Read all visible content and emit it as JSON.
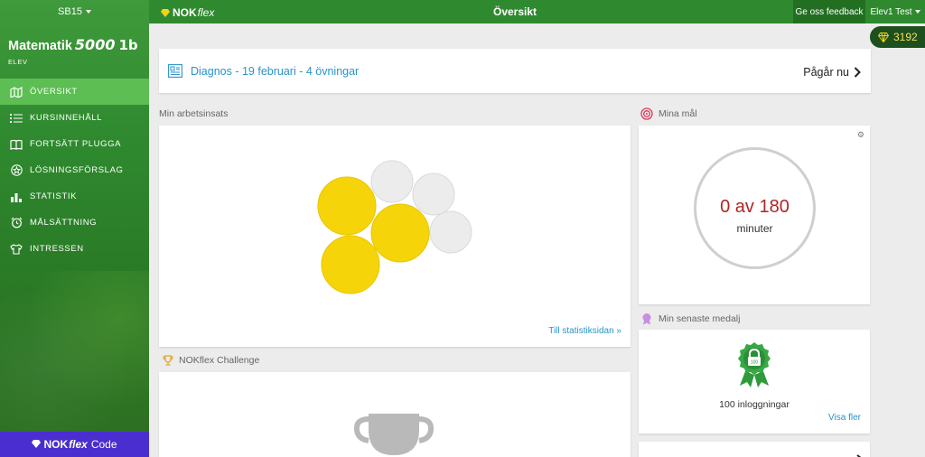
{
  "sidebar": {
    "selector_label": "SB15",
    "course": {
      "name": "Matematik",
      "number": "5000",
      "level": "1b"
    },
    "role": "ELEV",
    "items": [
      {
        "label": "ÖVERSIKT",
        "icon": "map-icon",
        "active": true
      },
      {
        "label": "KURSINNEHÅLL",
        "icon": "list-icon",
        "active": false
      },
      {
        "label": "FORTSÄTT PLUGGA",
        "icon": "book-icon",
        "active": false
      },
      {
        "label": "LÖSNINGSFÖRSLAG",
        "icon": "star-circle-icon",
        "active": false
      },
      {
        "label": "STATISTIK",
        "icon": "bar-chart-icon",
        "active": false
      },
      {
        "label": "MÅLSÄTTNING",
        "icon": "alarm-clock-icon",
        "active": false
      },
      {
        "label": "INTRESSEN",
        "icon": "shirt-icon",
        "active": false
      }
    ],
    "bottom": {
      "brand_bold": "NOK",
      "brand_italic": "flex",
      "suffix": "Code"
    }
  },
  "topbar": {
    "brand_bold": "NOK",
    "brand_italic": "flex",
    "title": "Översikt",
    "feedback": "Ge oss feedback",
    "user": "Elev1 Test"
  },
  "points": {
    "value": "3192",
    "icon": "diamond-icon"
  },
  "diagnosis": {
    "title": "Diagnos - 19 februari - 4 övningar",
    "status": "Pågår nu"
  },
  "effort": {
    "label": "Min arbetsinsats",
    "link": "Till statistiksidan »",
    "bubbles_filled": 3,
    "bubbles_total": 6
  },
  "goal": {
    "label": "Mina mål",
    "value": "0 av 180",
    "unit": "minuter",
    "progress": 0
  },
  "medal": {
    "label": "Min senaste medalj",
    "badge_text": "100",
    "text": "100 inloggningar",
    "link": "Visa fler"
  },
  "challenge": {
    "label": "NOKflex Challenge"
  },
  "colors": {
    "green": "#2f8a2f",
    "active": "#5cbe53",
    "link": "#2a93c9",
    "yellow": "#f5d50a",
    "purple": "#4a2ed0"
  }
}
